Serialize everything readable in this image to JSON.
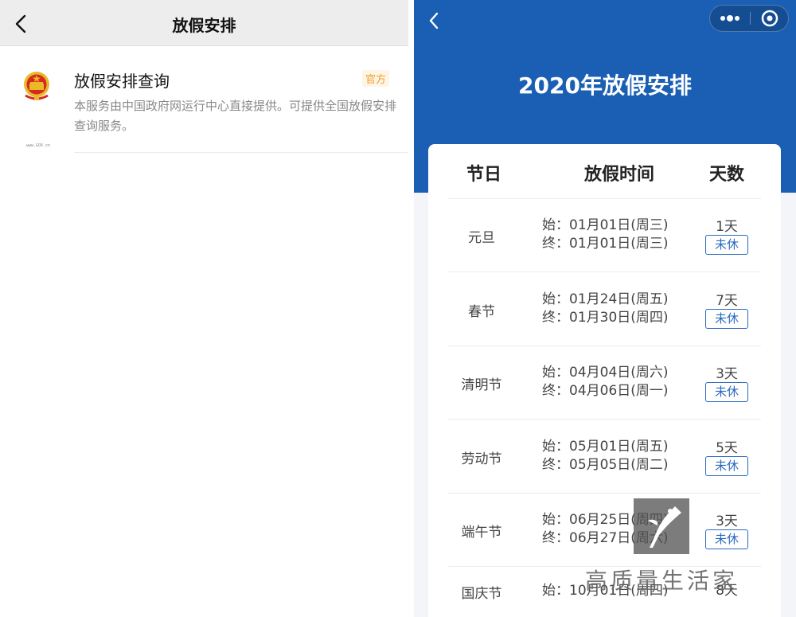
{
  "left": {
    "title": "放假安排",
    "result": {
      "name": "放假安排查询",
      "badge": "官方",
      "url": "www.GOV.cn",
      "description": "本服务由中国政府网运行中心直接提供。可提供全国放假安排查询服务。"
    }
  },
  "right": {
    "title": "2020年放假安排",
    "headers": {
      "festival": "节日",
      "time": "放假时间",
      "days": "天数"
    },
    "holidays": [
      {
        "name": "元旦",
        "start": "始：01月01日(周三)",
        "end": "终：01月01日(周三)",
        "days": "1天",
        "status": "未休"
      },
      {
        "name": "春节",
        "start": "始：01月24日(周五)",
        "end": "终：01月30日(周四)",
        "days": "7天",
        "status": "未休"
      },
      {
        "name": "清明节",
        "start": "始：04月04日(周六)",
        "end": "终：04月06日(周一)",
        "days": "3天",
        "status": "未休"
      },
      {
        "name": "劳动节",
        "start": "始：05月01日(周五)",
        "end": "终：05月05日(周二)",
        "days": "5天",
        "status": "未休"
      },
      {
        "name": "端午节",
        "start": "始：06月25日(周四)",
        "end": "终：06月27日(周六)",
        "days": "3天",
        "status": "未休"
      },
      {
        "name": "国庆节",
        "start": "始：10月01日(周四)",
        "end": "",
        "days": "8天",
        "status": ""
      }
    ]
  },
  "watermark": {
    "text": "高质量生活家"
  },
  "colors": {
    "brand_blue": "#1a5fb4",
    "tag_blue": "#2a6ac0",
    "badge_orange": "#f0a030"
  }
}
